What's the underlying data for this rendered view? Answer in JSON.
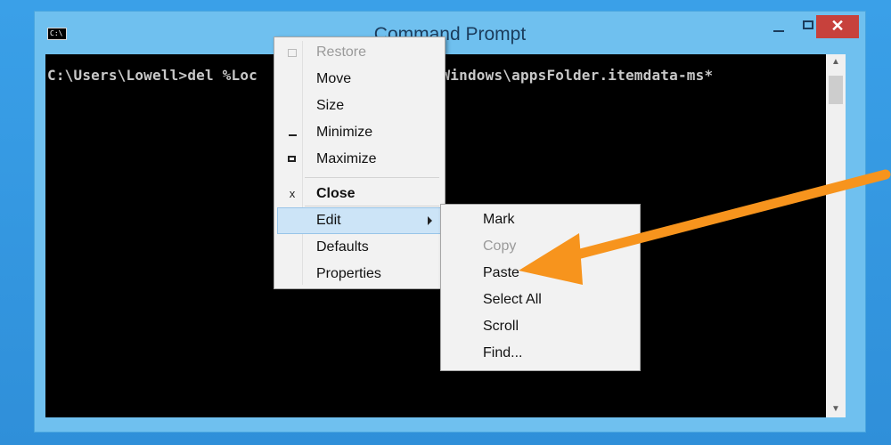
{
  "window": {
    "title": "Command Prompt",
    "icon": "cmd-icon",
    "icon_text": "C:\\"
  },
  "console": {
    "line": "C:\\Users\\Lowell>del %Loc                 oft\\Windows\\appsFolder.itemdata-ms*"
  },
  "system_menu": {
    "items": [
      {
        "label": "Restore",
        "icon": "restore-icon",
        "disabled": true
      },
      {
        "label": "Move"
      },
      {
        "label": "Size"
      },
      {
        "label": "Minimize",
        "icon": "minimize-icon"
      },
      {
        "label": "Maximize",
        "icon": "maximize-icon"
      },
      {
        "label": "Close",
        "icon": "close-icon",
        "glyph": "x",
        "bold": true
      },
      {
        "label": "Edit",
        "highlighted": true,
        "submenu": true
      },
      {
        "label": "Defaults"
      },
      {
        "label": "Properties"
      }
    ]
  },
  "edit_submenu": {
    "items": [
      {
        "label": "Mark"
      },
      {
        "label": "Copy",
        "disabled": true
      },
      {
        "label": "Paste"
      },
      {
        "label": "Select All"
      },
      {
        "label": "Scroll"
      },
      {
        "label": "Find..."
      }
    ]
  },
  "colors": {
    "desktop": "#2f8fd9",
    "titlebar": "#6fc0ef",
    "close_button": "#c7413c",
    "menu_highlight": "#cce4f7",
    "annotation_arrow": "#f7941d"
  }
}
